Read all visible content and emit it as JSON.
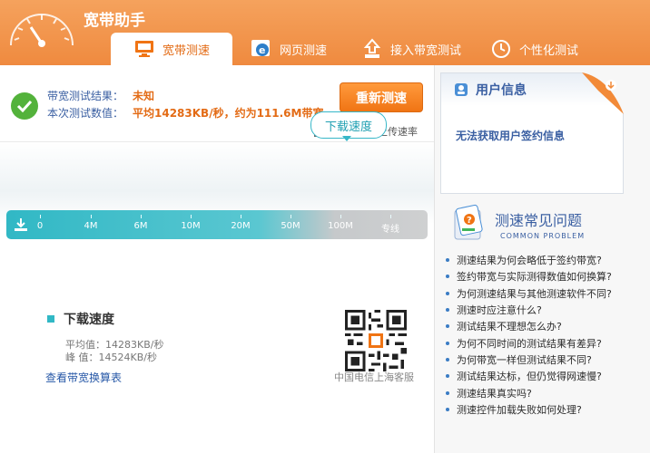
{
  "app": {
    "title": "宽带助手"
  },
  "tabs": [
    {
      "label": "宽带测速",
      "icon": "monitor-icon",
      "active": true
    },
    {
      "label": "网页测速",
      "icon": "browser-e-icon",
      "active": false
    },
    {
      "label": "接入带宽测试",
      "icon": "upload-arrow-icon",
      "active": false
    },
    {
      "label": "个性化测试",
      "icon": "clock-icon",
      "active": false
    }
  ],
  "result": {
    "label1": "带宽测试结果：",
    "value1": "未知",
    "label2": "本次测试数值：",
    "value2": "平均14283KB/秒，约为111.6M带宽。",
    "retest_label": "重新测速",
    "upload_label": "同时测试上传速率"
  },
  "speedbar": {
    "bubble": "下载速度",
    "ticks": [
      "0",
      "4M",
      "6M",
      "10M",
      "20M",
      "50M",
      "100M",
      "专线"
    ],
    "current_tick_index": 6
  },
  "download": {
    "title": "下载速度",
    "avg": "平均值：14283KB/秒",
    "peak": "峰  值：14524KB/秒",
    "calc_link": "查看带宽换算表"
  },
  "qr": {
    "caption": "中国电信上海客服"
  },
  "user": {
    "title": "用户信息",
    "message": "无法获取用户签约信息"
  },
  "faq": {
    "title": "测速常见问题",
    "subtitle": "COMMON PROBLEM",
    "items": [
      "测速结果为何会略低于签约带宽?",
      "签约带宽与实际测得数值如何换算?",
      "为何测速结果与其他测速软件不同?",
      "测速时应注意什么?",
      "测试结果不理想怎么办?",
      "为何不同时间的测试结果有差异?",
      "为何带宽一样但测试结果不同?",
      "测试结果达标，但仍觉得网速慢?",
      "测速结果真实吗?",
      "测速控件加载失败如何处理?"
    ]
  },
  "colors": {
    "header": "#ef8a3f",
    "accent": "#e36b15",
    "bar": "#31b8c5",
    "link": "#2758a7"
  }
}
